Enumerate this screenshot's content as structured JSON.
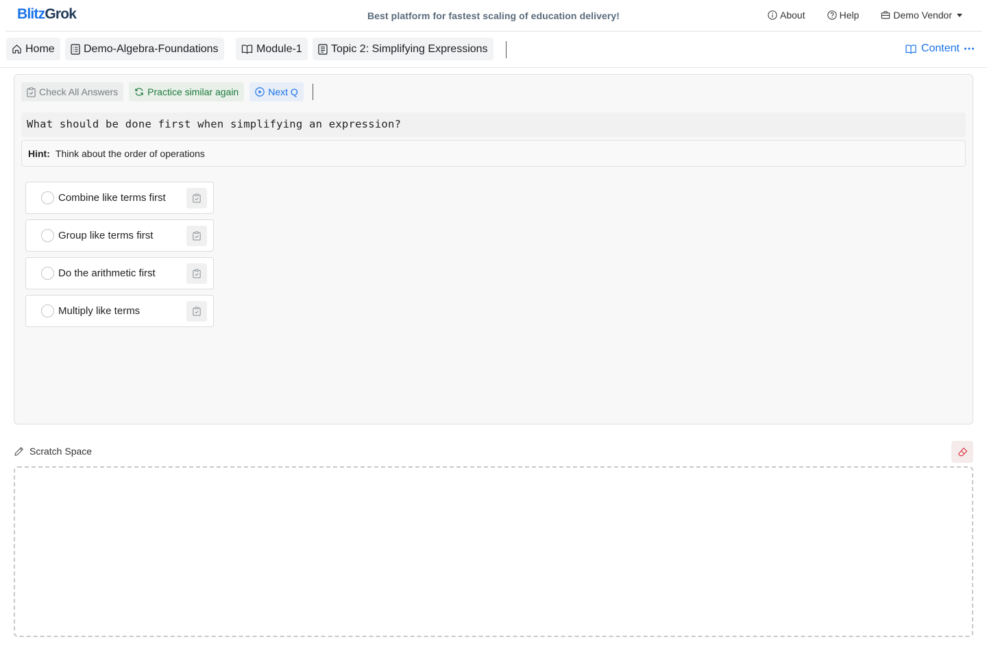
{
  "header": {
    "logo_part1": "Blitz",
    "logo_part2": "Grok",
    "tagline": "Best platform for fastest scaling of education delivery!",
    "about_label": "About",
    "help_label": "Help",
    "vendor_label": "Demo Vendor"
  },
  "breadcrumb": [
    {
      "label": "Home",
      "icon": "house-icon"
    },
    {
      "label": "Demo-Algebra-Foundations",
      "icon": "list-doc-icon"
    },
    {
      "label": "Module-1",
      "icon": "book-icon"
    },
    {
      "label": "Topic 2: Simplifying Expressions",
      "icon": "document-icon"
    }
  ],
  "content_menu": {
    "label": "Content",
    "icon": "book-icon"
  },
  "toolbar": {
    "check_label": "Check All Answers",
    "practice_label": "Practice similar again",
    "next_label": "Next Q"
  },
  "question": {
    "text": "What should be done first when simplifying an expression?",
    "hint_label": "Hint:",
    "hint_text": "Think about the order of operations"
  },
  "options": [
    {
      "label": "Combine like terms first"
    },
    {
      "label": "Group like terms first"
    },
    {
      "label": "Do the arithmetic first"
    },
    {
      "label": "Multiply like terms"
    }
  ],
  "scratch": {
    "title": "Scratch Space"
  },
  "colors": {
    "accent": "#1a73e8",
    "success": "#1b7a3b",
    "danger": "#dc3545"
  }
}
